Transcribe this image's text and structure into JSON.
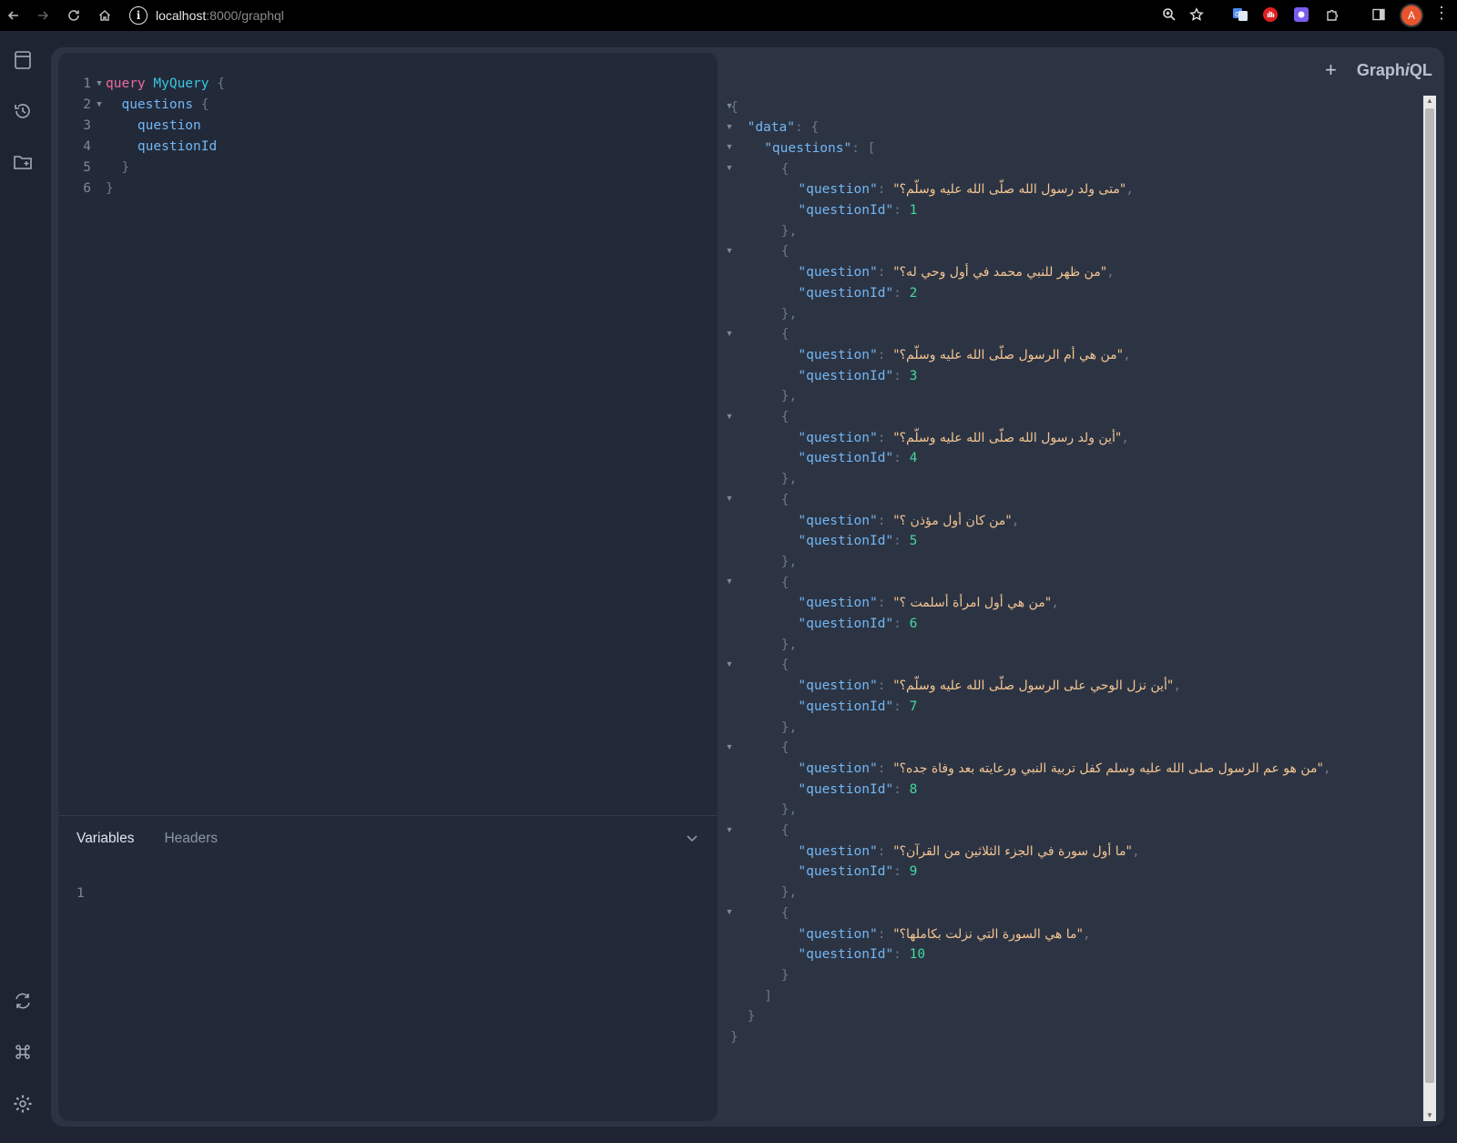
{
  "browser": {
    "url_host": "localhost",
    "url_path": ":8000/graphql",
    "avatar_letter": "A"
  },
  "app": {
    "logo_pre": "Graph",
    "logo_i": "i",
    "logo_post": "QL",
    "new_tab": "+"
  },
  "editor": {
    "lines": [
      {
        "n": "1",
        "fold": true,
        "indent": "",
        "parts": [
          {
            "t": "query",
            "c": "kw"
          },
          {
            "t": " ",
            "c": ""
          },
          {
            "t": "MyQuery",
            "c": "nm"
          },
          {
            "t": " {",
            "c": "pun"
          }
        ]
      },
      {
        "n": "2",
        "fold": true,
        "indent": "  ",
        "parts": [
          {
            "t": "questions",
            "c": "fld"
          },
          {
            "t": " {",
            "c": "pun"
          }
        ]
      },
      {
        "n": "3",
        "fold": false,
        "indent": "    ",
        "parts": [
          {
            "t": "question",
            "c": "fld"
          }
        ]
      },
      {
        "n": "4",
        "fold": false,
        "indent": "    ",
        "parts": [
          {
            "t": "questionId",
            "c": "fld"
          }
        ]
      },
      {
        "n": "5",
        "fold": false,
        "indent": "  ",
        "parts": [
          {
            "t": "}",
            "c": "pun"
          }
        ]
      },
      {
        "n": "6",
        "fold": false,
        "indent": "",
        "parts": [
          {
            "t": "}",
            "c": "pun"
          }
        ]
      }
    ]
  },
  "bottom_panel": {
    "tab_variables": "Variables",
    "tab_headers": "Headers",
    "line_number": "1"
  },
  "result": {
    "questions": [
      {
        "question": "متى ولد رسول الله صلّى الله عليه وسلّم؟",
        "questionId": 1
      },
      {
        "question": "من ظهر للنبي محمد في أول وحي له؟",
        "questionId": 2
      },
      {
        "question": "من هي أم الرسول صلّى الله عليه وسلّم؟",
        "questionId": 3
      },
      {
        "question": "أين ولد رسول الله صلّى الله عليه وسلّم؟",
        "questionId": 4
      },
      {
        "question": "من كان أول مؤذن ؟",
        "questionId": 5
      },
      {
        "question": "من هي أول امرأة أسلمت ؟",
        "questionId": 6
      },
      {
        "question": "أين نزل الوحي على الرسول صلّى الله عليه وسلّم؟",
        "questionId": 7
      },
      {
        "question": "من هو عم الرسول صلى الله عليه وسلم كفل تربية النبي ورعايته بعد وفاة جده؟",
        "questionId": 8
      },
      {
        "question": "ما أول سورة في الجزء الثلاثين من القرآن؟",
        "questionId": 9
      },
      {
        "question": "ما هي السورة التي نزلت بكاملها؟",
        "questionId": 10
      }
    ]
  },
  "colors": {
    "run_button": "#f0649e",
    "background": "#1f2432",
    "editor": "#222a3a",
    "string": "#f4c591",
    "number": "#44d89a",
    "key": "#74b6f2"
  }
}
